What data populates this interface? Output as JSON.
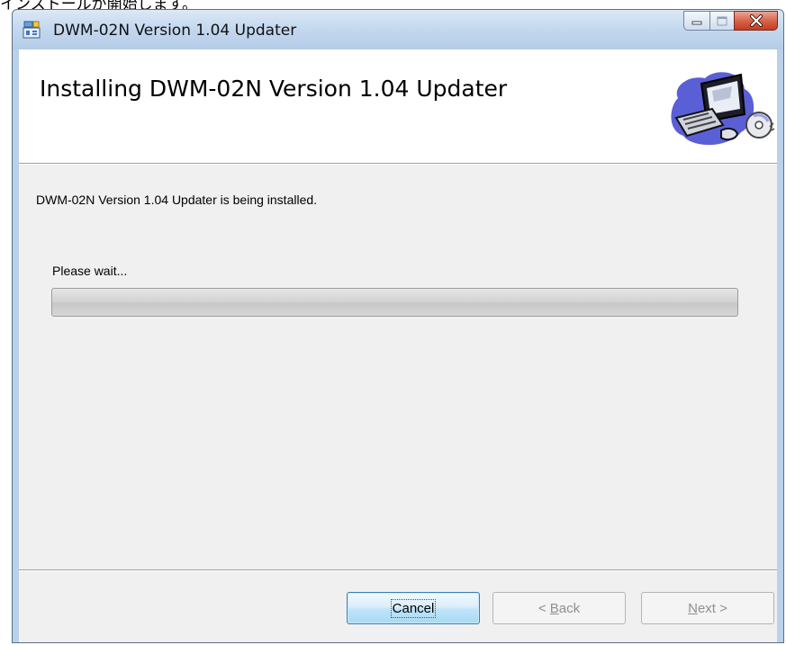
{
  "page_caption": "インストールが開始します。",
  "window": {
    "title": "DWM-02N Version 1.04 Updater",
    "icons": {
      "app": "installer-icon",
      "minimize": "minimize-icon",
      "maximize": "maximize-icon",
      "close": "close-icon",
      "banner": "computer-setup-graphic"
    }
  },
  "banner": {
    "title": "Installing DWM-02N Version 1.04 Updater"
  },
  "body": {
    "status_text": "DWM-02N Version 1.04 Updater is being installed.",
    "wait_text": "Please wait...",
    "progress_percent": 0
  },
  "buttons": {
    "cancel": "Cancel",
    "back_prefix": "< ",
    "back_mnemonic": "B",
    "back_rest": "ack",
    "next_mnemonic": "N",
    "next_rest": "ext >"
  },
  "colors": {
    "close_button": "#c9442a",
    "default_button_border": "#3c7fb1",
    "title_bar": "#c3d7ee"
  }
}
